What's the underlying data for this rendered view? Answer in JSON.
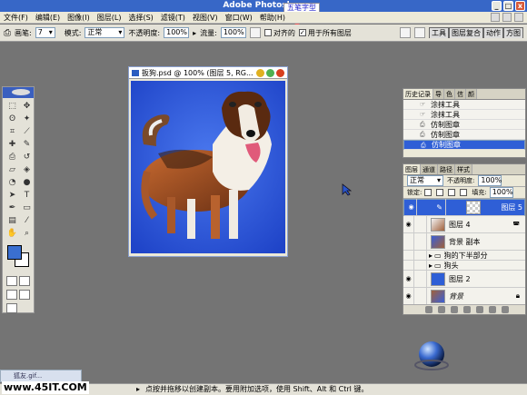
{
  "app": {
    "title": "Adobe Photoshop",
    "brand_tag": "五笔字型"
  },
  "menu": [
    "文件(F)",
    "编辑(E)",
    "图像(I)",
    "图层(L)",
    "选择(S)",
    "滤镜(T)",
    "视图(V)",
    "窗口(W)",
    "帮助(H)"
  ],
  "options": {
    "brush_label": "画笔:",
    "brush_size": "7",
    "mode_label": "模式:",
    "mode_value": "正常",
    "opacity_label": "不透明度:",
    "opacity_value": "100%",
    "flow_label": "流量:",
    "flow_value": "100%",
    "aligned_label": "对齐的",
    "all_layers_label": "用于所有图层"
  },
  "workspace_tabs": [
    "工具",
    "图层复合",
    "动作",
    "方图"
  ],
  "document": {
    "title": "扳狗.psd @ 100% (图层 5, RG..."
  },
  "history": {
    "tabs": [
      "历史记录",
      "导",
      "色",
      "信",
      "颜"
    ],
    "items": [
      {
        "label": "涂抹工具",
        "selected": false
      },
      {
        "label": "涂抹工具",
        "selected": false
      },
      {
        "label": "仿制图章",
        "selected": false
      },
      {
        "label": "仿制图章",
        "selected": false
      },
      {
        "label": "仿制图章",
        "selected": true
      }
    ]
  },
  "layers": {
    "tabs": [
      "图层",
      "通道",
      "路径",
      "样式"
    ],
    "blend_mode": "正常",
    "opacity_label": "不透明度:",
    "opacity_value": "100%",
    "lock_label": "锁定:",
    "fill_label": "填充:",
    "fill_value": "100%",
    "rows": [
      {
        "name": "图层 5",
        "selected": true,
        "kind": "layer"
      },
      {
        "name": "图层 4",
        "selected": false,
        "kind": "layer"
      },
      {
        "name": "背景 副本",
        "selected": false,
        "kind": "layer"
      },
      {
        "name": "狗的下半部分",
        "selected": false,
        "kind": "group"
      },
      {
        "name": "狗头",
        "selected": false,
        "kind": "group"
      },
      {
        "name": "图层 2",
        "selected": false,
        "kind": "layer"
      },
      {
        "name": "背景",
        "selected": false,
        "kind": "layer"
      }
    ]
  },
  "status": {
    "text": "点按并拖移以创建副本。要用附加选项，使用 Shift、Alt 和 Ctrl 键。"
  },
  "site": {
    "url": "www.45IT.COM"
  },
  "minimized_window": {
    "title": "狐友.gif..."
  },
  "colors": {
    "titlebar": "#3767c7",
    "canvas_bg": "#2a53d6",
    "selection": "#2f5fd6",
    "workspace": "#747474"
  }
}
